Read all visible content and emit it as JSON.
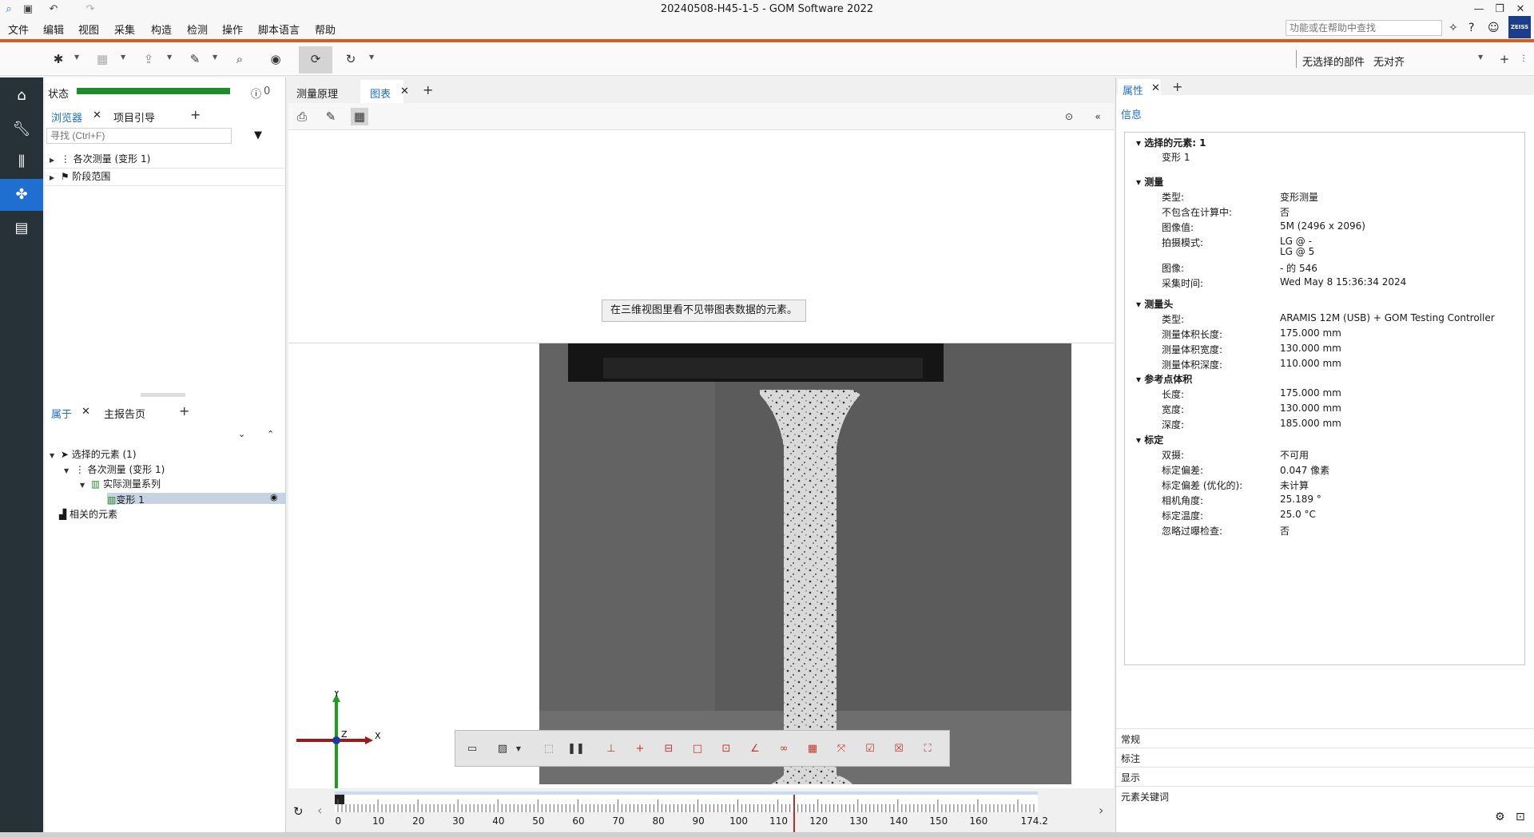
{
  "window": {
    "title": "20240508-H45-1-5 - GOM Software 2022"
  },
  "help_search": {
    "placeholder": "功能或在帮助中查找"
  },
  "menu": [
    "文件",
    "编辑",
    "视图",
    "采集",
    "构造",
    "检测",
    "操作",
    "脚本语言",
    "帮助"
  ],
  "toolbar": {
    "part_label": "无选择的部件",
    "align_label": "无对齐"
  },
  "left_panel": {
    "status_label": "状态",
    "status_count": "0",
    "tabs_top": [
      "浏览器",
      "项目引导"
    ],
    "search_placeholder": "寻找 (Ctrl+F)",
    "tree_top": [
      "各次测量 (变形 1)",
      "阶段范围"
    ],
    "tabs_bottom": [
      "属于",
      "主报告页"
    ],
    "tree_bottom": [
      "选择的元素 (1)",
      "各次测量 (变形 1)",
      "实际测量系列",
      "变形 1",
      "相关的元素"
    ]
  },
  "center": {
    "tabs": [
      "测量原理",
      "图表"
    ],
    "hint": "在三维视图里看不见带图表数据的元素。",
    "axes": {
      "x": "X",
      "y": "Y",
      "z": "Z"
    },
    "timeline_labels": [
      "0",
      "10",
      "20",
      "30",
      "40",
      "50",
      "60",
      "70",
      "80",
      "90",
      "100",
      "110",
      "120",
      "130",
      "140",
      "150",
      "160",
      "174.2"
    ]
  },
  "right_panel": {
    "tab": "属性",
    "info": "信息",
    "sections": {
      "selected": {
        "title": "选择的元素: 1",
        "item": "变形 1"
      },
      "measurement": {
        "title": "测量",
        "rows": [
          [
            "类型:",
            "变形测量"
          ],
          [
            "不包含在计算中:",
            "否"
          ],
          [
            "图像值:",
            "5M (2496 x 2096)"
          ],
          [
            "拍摄模式:",
            "LG @ -"
          ],
          [
            "",
            "LG @ 5"
          ],
          [
            "图像:",
            "- 的 546"
          ],
          [
            "采集时间:",
            "Wed May  8 15:36:34 2024"
          ]
        ]
      },
      "sensor": {
        "title": "测量头",
        "rows": [
          [
            "类型:",
            "ARAMIS 12M (USB) + GOM Testing Controller"
          ],
          [
            "测量体积长度:",
            "175.000 mm"
          ],
          [
            "测量体积宽度:",
            "130.000 mm"
          ],
          [
            "测量体积深度:",
            "110.000 mm"
          ]
        ]
      },
      "reference": {
        "title": "参考点体积",
        "rows": [
          [
            "长度:",
            "175.000 mm"
          ],
          [
            "宽度:",
            "130.000 mm"
          ],
          [
            "深度:",
            "185.000 mm"
          ]
        ]
      },
      "calibration": {
        "title": "标定",
        "rows": [
          [
            "双摄:",
            "不可用"
          ],
          [
            "标定偏差:",
            "0.047 像素"
          ],
          [
            "标定偏差 (优化的):",
            "未计算"
          ],
          [
            "相机角度:",
            "25.189 °"
          ],
          [
            "标定温度:",
            "25.0 °C"
          ],
          [
            "忽略过曝检查:",
            "否"
          ]
        ]
      }
    },
    "bottom_sections": [
      "常规",
      "标注",
      "显示",
      "元素关键词"
    ]
  }
}
